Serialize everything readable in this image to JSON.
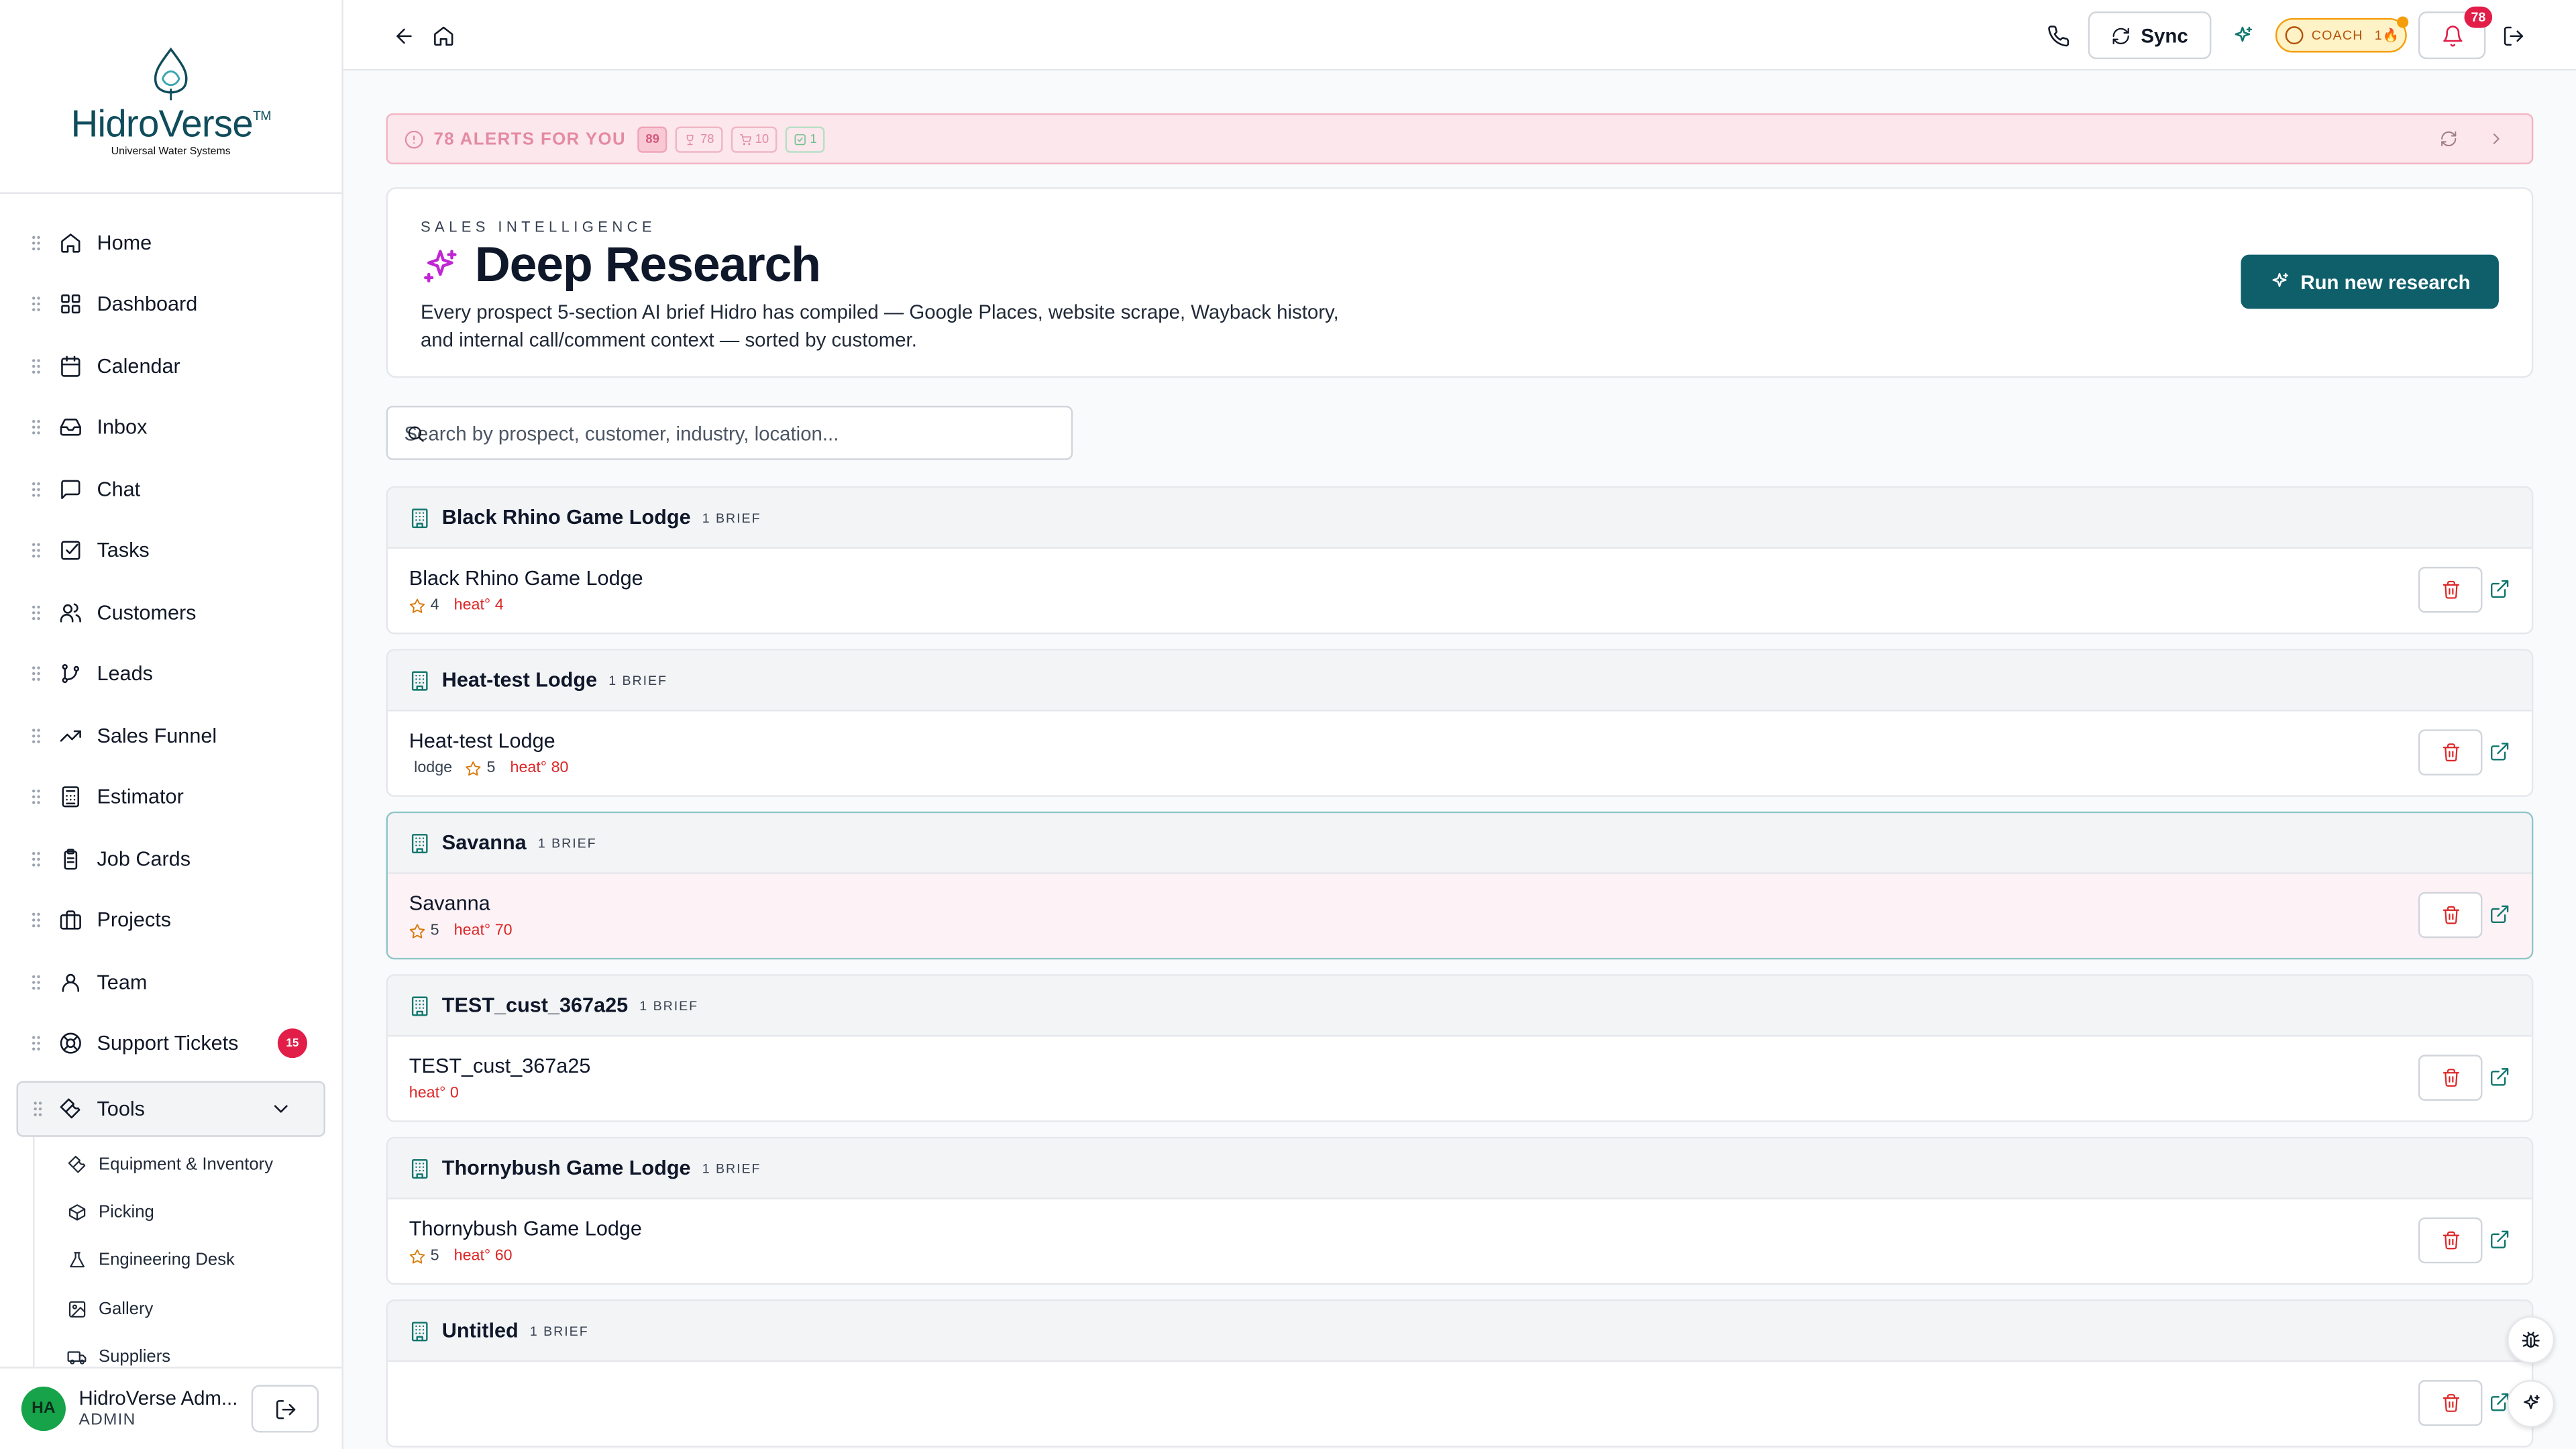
{
  "brand": {
    "name_part1": "Hidro",
    "name_part2": "Verse",
    "tm": "TM",
    "tagline": "Universal Water Systems"
  },
  "sidebar": {
    "items": [
      {
        "label": "Home",
        "icon": "home-icon"
      },
      {
        "label": "Dashboard",
        "icon": "grid-icon"
      },
      {
        "label": "Calendar",
        "icon": "calendar-icon"
      },
      {
        "label": "Inbox",
        "icon": "inbox-icon"
      },
      {
        "label": "Chat",
        "icon": "chat-icon"
      },
      {
        "label": "Tasks",
        "icon": "check-square-icon"
      },
      {
        "label": "Customers",
        "icon": "users-icon"
      },
      {
        "label": "Leads",
        "icon": "branch-icon"
      },
      {
        "label": "Sales Funnel",
        "icon": "trending-up-icon"
      },
      {
        "label": "Estimator",
        "icon": "calculator-icon"
      },
      {
        "label": "Job Cards",
        "icon": "clipboard-icon"
      },
      {
        "label": "Projects",
        "icon": "briefcase-icon"
      },
      {
        "label": "Team",
        "icon": "team-icon"
      },
      {
        "label": "Support Tickets",
        "icon": "lifebuoy-icon",
        "badge": "15"
      }
    ],
    "tools": {
      "label": "Tools",
      "children": [
        "Equipment & Inventory",
        "Picking",
        "Engineering Desk",
        "Gallery",
        "Suppliers"
      ]
    },
    "user": {
      "initials": "HA",
      "name": "HidroVerse Adm...",
      "role": "ADMIN"
    }
  },
  "topbar": {
    "sync_label": "Sync",
    "coach_label": "COACH",
    "coach_count": "1🔥",
    "notification_count": "78"
  },
  "alerts": {
    "title": "78 ALERTS FOR YOU",
    "total": "89",
    "chips": [
      "78",
      "10",
      "1"
    ]
  },
  "hero": {
    "eyebrow": "SALES INTELLIGENCE",
    "title": "Deep Research",
    "description": "Every prospect 5-section AI brief Hidro has compiled — Google Places, website scrape, Wayback history, and internal call/comment context — sorted by customer.",
    "run_button": "Run new research"
  },
  "search": {
    "placeholder": "Search by prospect, customer, industry, location..."
  },
  "groups": [
    {
      "name": "Black Rhino Game Lodge",
      "count": "1 BRIEF",
      "row_name": "Black Rhino Game Lodge",
      "tag": "",
      "rating": "4",
      "heat": "heat° 4"
    },
    {
      "name": "Heat-test Lodge",
      "count": "1 BRIEF",
      "row_name": "Heat-test Lodge",
      "tag": "lodge",
      "rating": "5",
      "heat": "heat° 80"
    },
    {
      "name": "Savanna",
      "count": "1 BRIEF",
      "row_name": "Savanna",
      "tag": "",
      "rating": "5",
      "heat": "heat° 70",
      "active": true
    },
    {
      "name": "TEST_cust_367a25",
      "count": "1 BRIEF",
      "row_name": "TEST_cust_367a25",
      "tag": "",
      "rating": "",
      "heat": "heat° 0"
    },
    {
      "name": "Thornybush Game Lodge",
      "count": "1 BRIEF",
      "row_name": "Thornybush Game Lodge",
      "tag": "",
      "rating": "5",
      "heat": "heat° 60"
    },
    {
      "name": "Untitled",
      "count": "1 BRIEF",
      "row_name": "",
      "tag": "",
      "rating": "",
      "heat": ""
    }
  ],
  "colors": {
    "accent": "#0f5f6a",
    "alert": "#e11d48",
    "heat": "#dc2626"
  }
}
